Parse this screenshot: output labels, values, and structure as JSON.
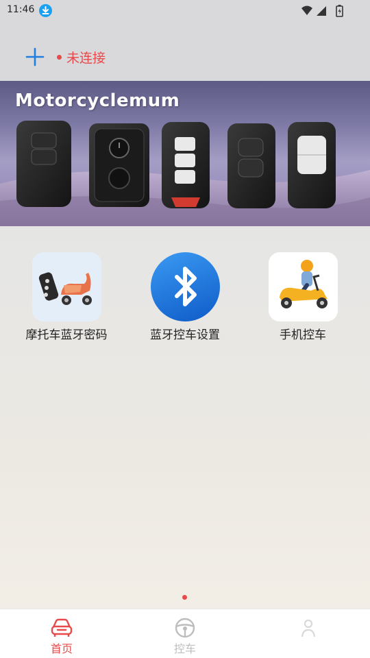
{
  "status_bar": {
    "time": "11:46"
  },
  "header": {
    "connection_status": "未连接"
  },
  "banner": {
    "brand_text": "Motorcyclemum"
  },
  "features": [
    {
      "label": "摩托车蓝牙密码",
      "icon": "scooter-key-icon"
    },
    {
      "label": "蓝牙控车设置",
      "icon": "bluetooth-icon"
    },
    {
      "label": "手机控车",
      "icon": "rider-scooter-icon"
    }
  ],
  "bottom_nav": {
    "items": [
      {
        "label": "首页",
        "icon": "car-icon",
        "active": true
      },
      {
        "label": "控车",
        "icon": "steering-wheel-icon",
        "active": false
      },
      {
        "label": "",
        "icon": "person-icon",
        "active": false
      }
    ]
  },
  "colors": {
    "accent_red": "#e8494a",
    "accent_blue": "#1f7ee0",
    "inactive_gray": "#bdbdbd"
  }
}
